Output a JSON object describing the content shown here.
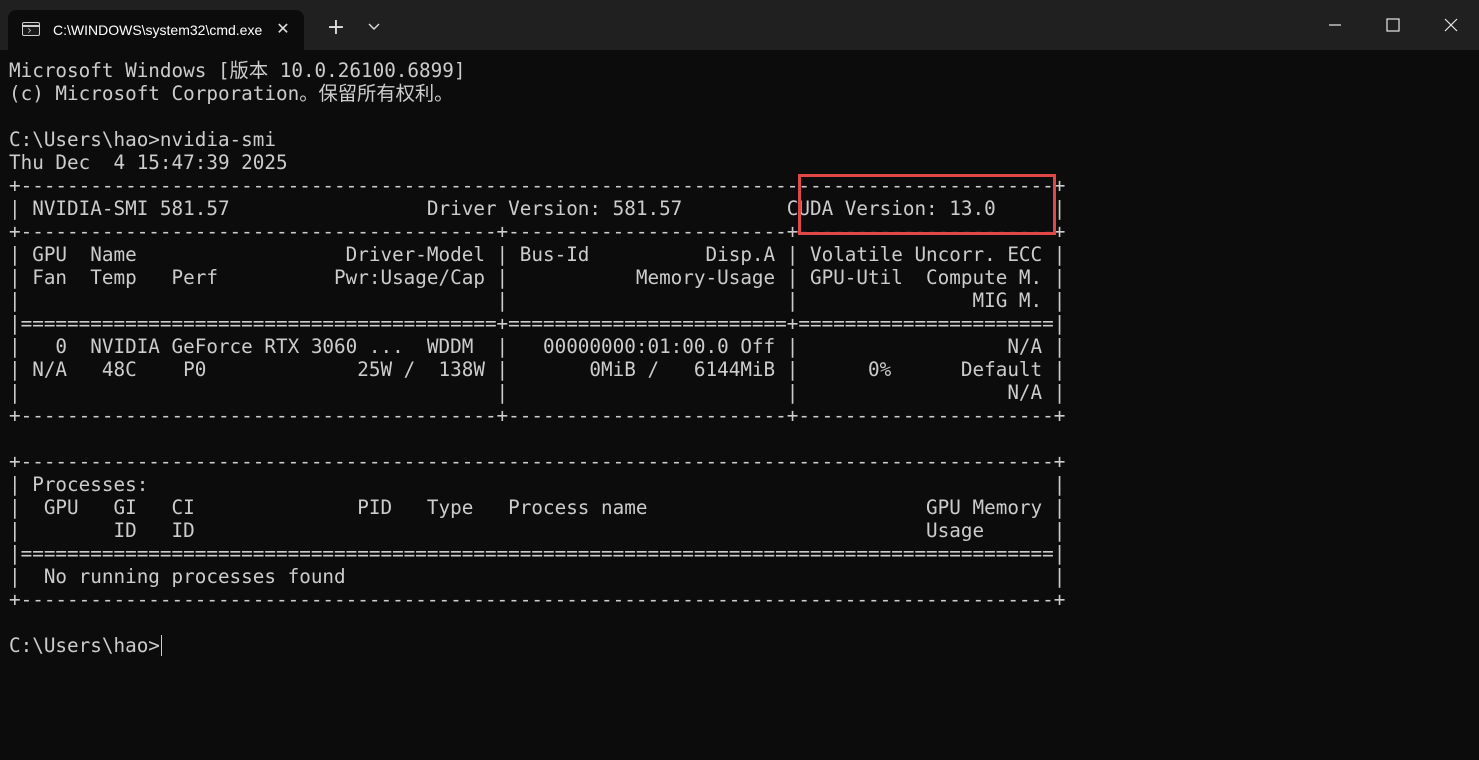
{
  "tab": {
    "title": "C:\\WINDOWS\\system32\\cmd.exe"
  },
  "icons": {
    "tab": "terminal-icon",
    "tab_close": "close-icon",
    "new_tab": "plus-icon",
    "dropdown": "chevron-down-icon",
    "minimize": "minimize-icon",
    "maximize": "maximize-icon",
    "close": "close-icon"
  },
  "colors": {
    "background": "#0c0c0c",
    "titlebar": "#202020",
    "text": "#cccccc",
    "highlight": "#e04848"
  },
  "console": {
    "lines": [
      "Microsoft Windows [版本 10.0.26100.6899]",
      "(c) Microsoft Corporation。保留所有权利。",
      "",
      "C:\\Users\\hao>nvidia-smi",
      "Thu Dec  4 15:47:39 2025",
      "+-----------------------------------------------------------------------------------------+",
      "| NVIDIA-SMI 581.57                 Driver Version: 581.57         CUDA Version: 13.0     |",
      "+-----------------------------------------+------------------------+----------------------+",
      "| GPU  Name                  Driver-Model | Bus-Id          Disp.A | Volatile Uncorr. ECC |",
      "| Fan  Temp   Perf          Pwr:Usage/Cap |           Memory-Usage | GPU-Util  Compute M. |",
      "|                                         |                        |               MIG M. |",
      "|=========================================+========================+======================|",
      "|   0  NVIDIA GeForce RTX 3060 ...  WDDM  |   00000000:01:00.0 Off |                  N/A |",
      "| N/A   48C    P0             25W /  138W |       0MiB /   6144MiB |      0%      Default |",
      "|                                         |                        |                  N/A |",
      "+-----------------------------------------+------------------------+----------------------+",
      "",
      "+-----------------------------------------------------------------------------------------+",
      "| Processes:                                                                              |",
      "|  GPU   GI   CI              PID   Type   Process name                        GPU Memory |",
      "|        ID   ID                                                               Usage      |",
      "|=========================================================================================|",
      "|  No running processes found                                                             |",
      "+-----------------------------------------------------------------------------------------+",
      "",
      "C:\\Users\\hao>"
    ]
  }
}
